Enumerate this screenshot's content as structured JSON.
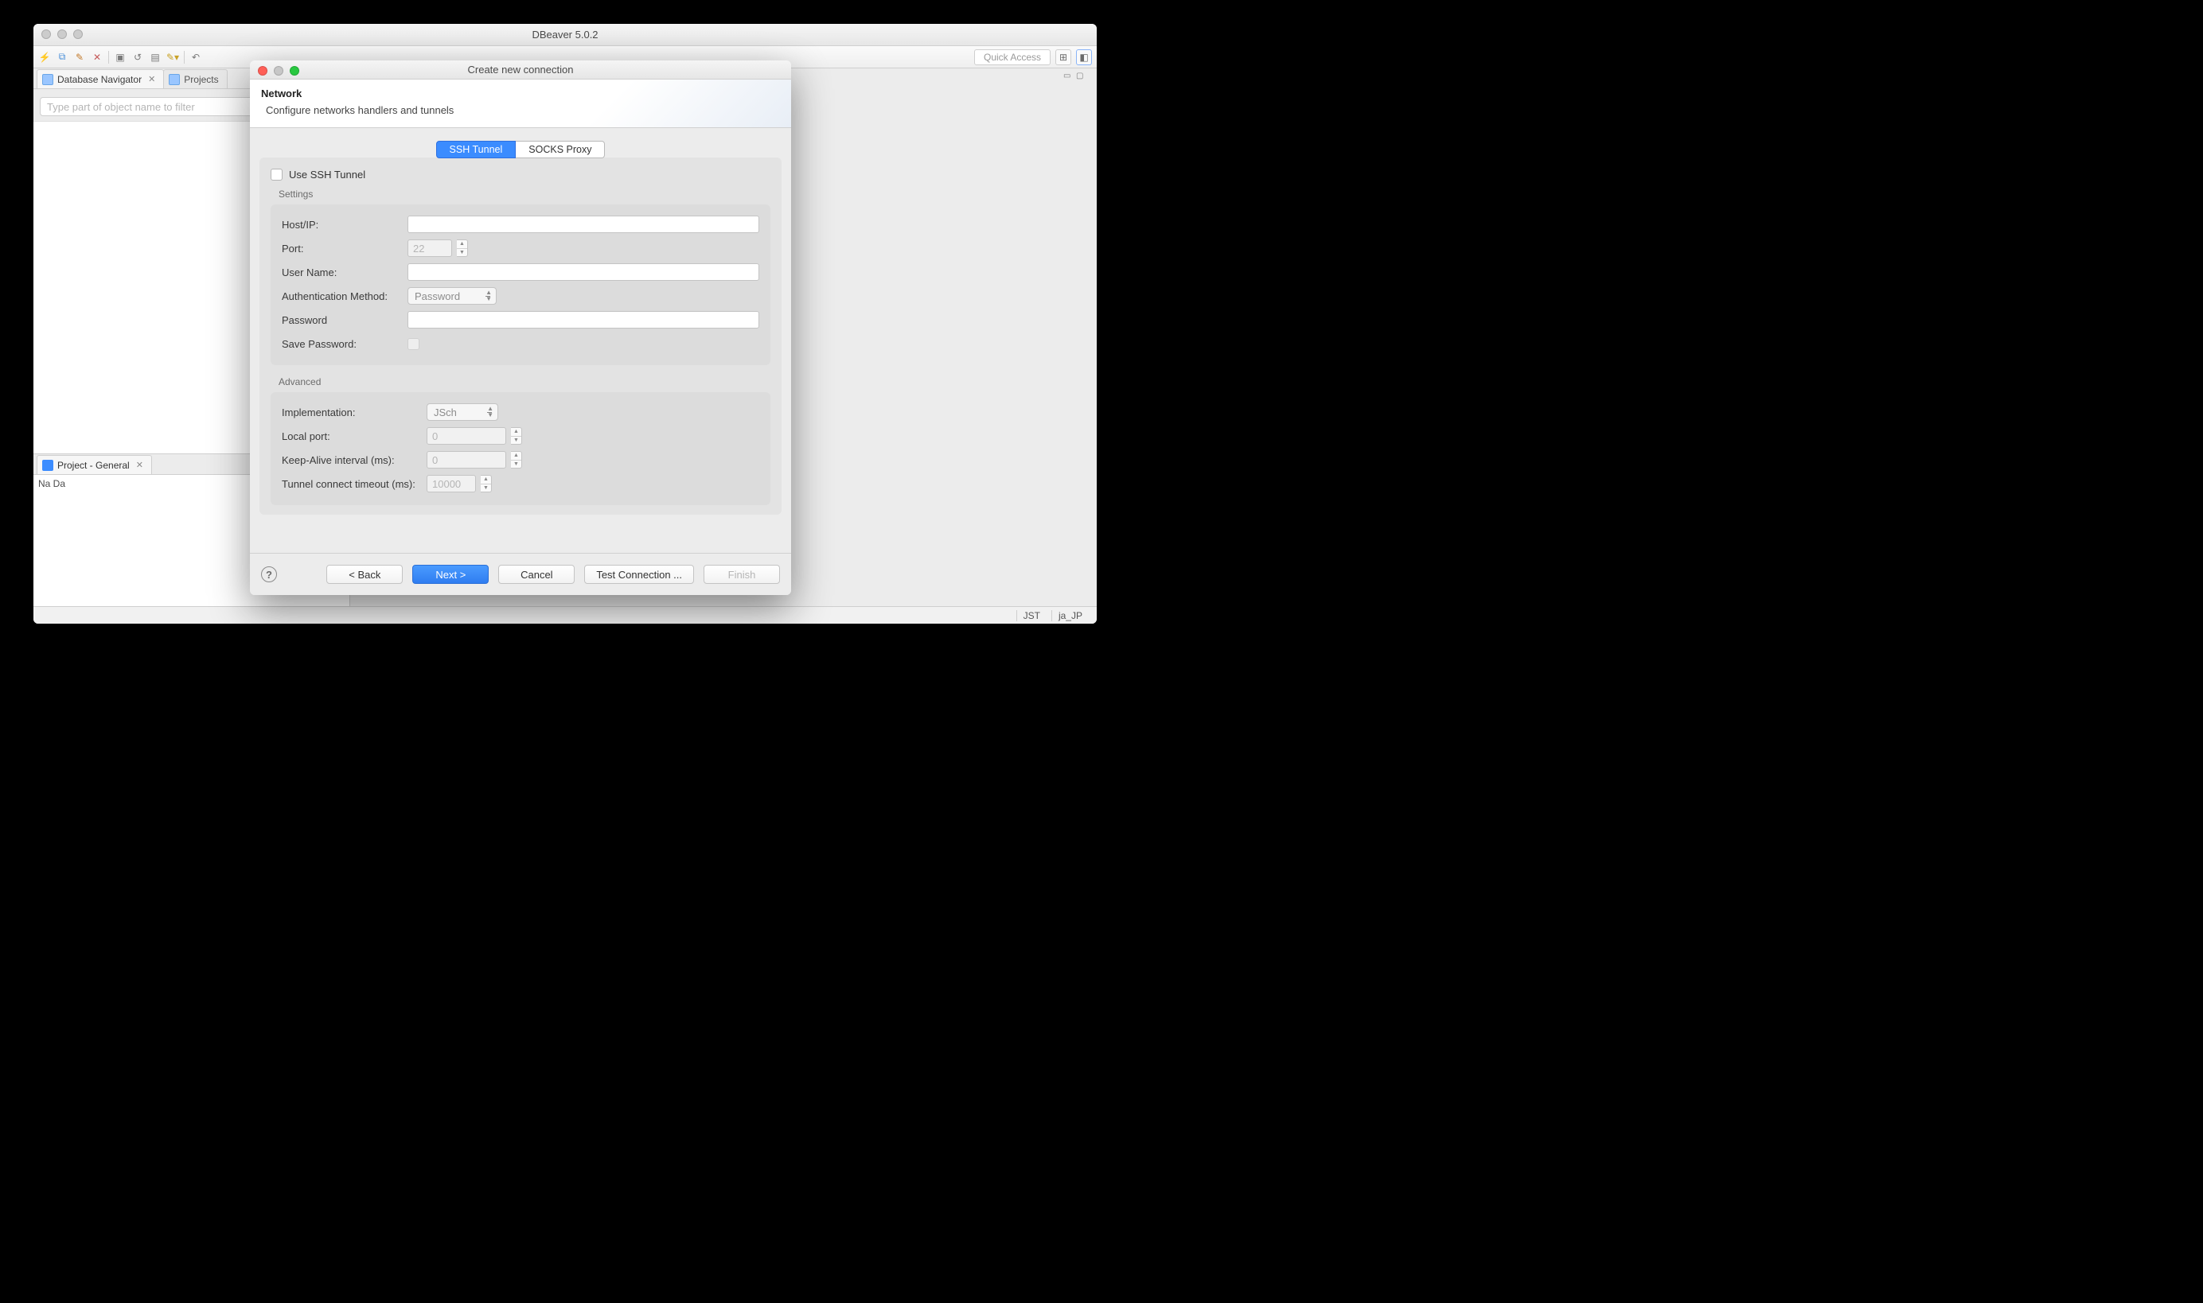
{
  "app": {
    "title": "DBeaver 5.0.2",
    "quick_access_placeholder": "Quick Access"
  },
  "left": {
    "tab_navigator": "Database Navigator",
    "tab_projects": "Projects",
    "filter_placeholder": "Type part of object name to filter"
  },
  "bottom_left": {
    "tab_title": "Project - General",
    "columns": "Na Da"
  },
  "status": {
    "tz": "JST",
    "locale": "ja_JP"
  },
  "dialog": {
    "title": "Create new connection",
    "header_title": "Network",
    "header_desc": "Configure networks handlers and tunnels",
    "tabs": {
      "ssh": "SSH Tunnel",
      "socks": "SOCKS Proxy"
    },
    "use_ssh": "Use SSH Tunnel",
    "group_settings": "Settings",
    "group_advanced": "Advanced",
    "labels": {
      "host": "Host/IP:",
      "port": "Port:",
      "user": "User Name:",
      "auth": "Authentication Method:",
      "password": "Password",
      "save_pw": "Save Password:",
      "impl": "Implementation:",
      "local_port": "Local port:",
      "keepalive": "Keep-Alive interval (ms):",
      "timeout": "Tunnel connect timeout (ms):"
    },
    "values": {
      "port": "22",
      "auth": "Password",
      "impl": "JSch",
      "local_port": "0",
      "keepalive": "0",
      "timeout": "10000"
    },
    "buttons": {
      "back": "< Back",
      "next": "Next >",
      "cancel": "Cancel",
      "test": "Test Connection ...",
      "finish": "Finish"
    }
  }
}
